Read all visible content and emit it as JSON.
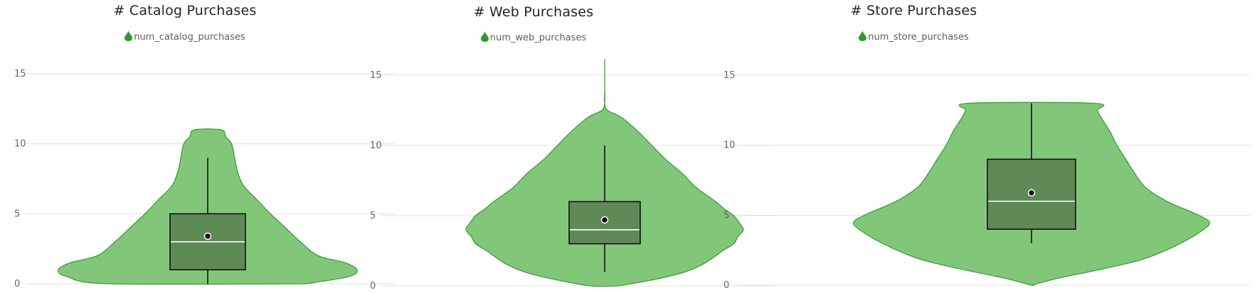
{
  "colors": {
    "violin_fill": "#6cbd62",
    "violin_stroke": "#3aa035",
    "box_fill": "#5e8a55",
    "grid": "#e1e1e1",
    "legend_marker": "#2e9b2c"
  },
  "chart_data": [
    {
      "type": "violin",
      "title": "# Catalog Purchases",
      "legend": [
        "num_catalog_purchases"
      ],
      "ylim": [
        0,
        16
      ],
      "yticks": [
        "0",
        "5",
        "10",
        "15"
      ],
      "grid": true,
      "legend_position": "top-center",
      "box": {
        "min": 0,
        "q1": 1,
        "median": 3,
        "q3": 5,
        "max": 9,
        "mean": 3.4
      },
      "density_y": [
        0,
        0.5,
        1,
        1.5,
        2,
        3,
        4,
        5,
        6,
        7,
        8,
        9,
        10,
        10.5,
        11
      ],
      "density_width": [
        0.65,
        0.94,
        1.0,
        0.92,
        0.74,
        0.62,
        0.52,
        0.42,
        0.33,
        0.24,
        0.2,
        0.18,
        0.16,
        0.12,
        0.09
      ]
    },
    {
      "type": "violin",
      "title": "# Web Purchases",
      "legend": [
        "num_web_purchases"
      ],
      "ylim": [
        0,
        16
      ],
      "yticks": [
        "0",
        "5",
        "10",
        "15"
      ],
      "grid": true,
      "legend_position": "top-center",
      "box": {
        "min": 1,
        "q1": 3,
        "median": 4,
        "q3": 6,
        "max": 10,
        "mean": 4.7
      },
      "density_y": [
        0,
        0.5,
        1,
        1.5,
        2,
        2.5,
        3,
        3.5,
        4,
        4.5,
        5,
        5.5,
        6,
        7,
        8,
        9,
        10,
        11,
        12,
        12.5,
        13,
        14,
        15,
        16
      ],
      "density_width": [
        0.1,
        0.38,
        0.58,
        0.7,
        0.78,
        0.85,
        0.93,
        0.96,
        1.0,
        0.97,
        0.93,
        0.86,
        0.8,
        0.66,
        0.56,
        0.44,
        0.34,
        0.24,
        0.12,
        0.02,
        0.0,
        0.0,
        0.0,
        0.0
      ]
    },
    {
      "type": "violin",
      "title": "# Store Purchases",
      "legend": [
        "num_store_purchases"
      ],
      "ylim": [
        0,
        16
      ],
      "yticks": [
        "0",
        "5",
        "10",
        "15"
      ],
      "grid": true,
      "legend_position": "top-center",
      "box": {
        "min": 3,
        "q1": 4,
        "median": 6,
        "q3": 9,
        "max": 13,
        "mean": 6.6
      },
      "density_y": [
        0,
        0.5,
        1,
        1.5,
        2,
        3,
        4,
        4.5,
        5,
        6,
        7,
        8,
        9,
        10,
        11,
        12,
        12.5,
        13
      ],
      "density_width": [
        0.0,
        0.15,
        0.34,
        0.52,
        0.66,
        0.84,
        0.97,
        1.0,
        0.94,
        0.76,
        0.64,
        0.58,
        0.53,
        0.48,
        0.44,
        0.39,
        0.37,
        0.35
      ]
    }
  ]
}
